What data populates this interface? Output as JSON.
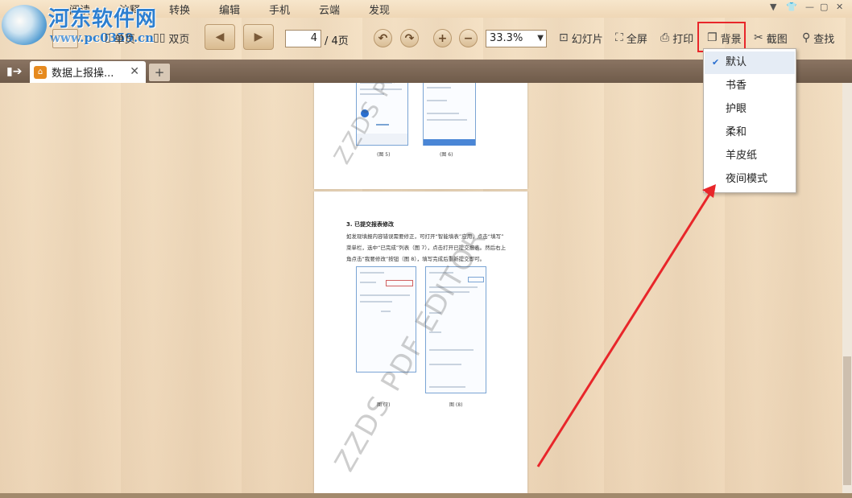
{
  "watermark_logo": {
    "title": "河东软件网",
    "url": "www.pc0359.cn"
  },
  "menu": [
    {
      "label": "阅读"
    },
    {
      "label": "注释"
    },
    {
      "label": "转换"
    },
    {
      "label": "编辑"
    },
    {
      "label": "手机"
    },
    {
      "label": "云端"
    },
    {
      "label": "发现"
    }
  ],
  "toolbar": {
    "single_page": "单页",
    "double_page": "双页",
    "page_current": "4",
    "page_total": "/ 4页",
    "zoom": "33.3%",
    "slideshow": "幻灯片",
    "fullscreen": "全屏",
    "print": "打印",
    "background": "背景",
    "screenshot": "截图",
    "find": "查找"
  },
  "tabs": {
    "active_label": "数据上报操...",
    "close": "✕",
    "add": "+"
  },
  "background_menu": {
    "items": [
      {
        "label": "默认",
        "selected": true
      },
      {
        "label": "书香",
        "selected": false
      },
      {
        "label": "护眼",
        "selected": false
      },
      {
        "label": "柔和",
        "selected": false
      },
      {
        "label": "羊皮纸",
        "selected": false
      },
      {
        "label": "夜间模式",
        "selected": false
      }
    ]
  },
  "document": {
    "figure_5": "(图 5)",
    "figure_6": "(图 6)",
    "section_heading": "3. 已提交报表修改",
    "para_line1": "如发现填报内容错误需要修正，可打开“智能填表”应用，点击“填写”",
    "para_line2": "菜单栏，选中“已完成”列表（图 7），点击打开已提交报表。然后右上",
    "para_line3": "角点击“我要修改”按钮（图 8），填写完成后重新提交即可。",
    "figure_7": "图 (7)",
    "figure_8": "图 (8)",
    "watermark": "ZZDS PDF EDITOR"
  },
  "colors": {
    "highlight": "#e8262a",
    "accent_blue": "#2a6fd0"
  },
  "icons": {
    "slideshow": "slideshow-icon",
    "fullscreen": "fullscreen-icon",
    "print": "printer-icon",
    "background": "background-icon",
    "screenshot": "scissors-icon",
    "find": "search-icon"
  }
}
